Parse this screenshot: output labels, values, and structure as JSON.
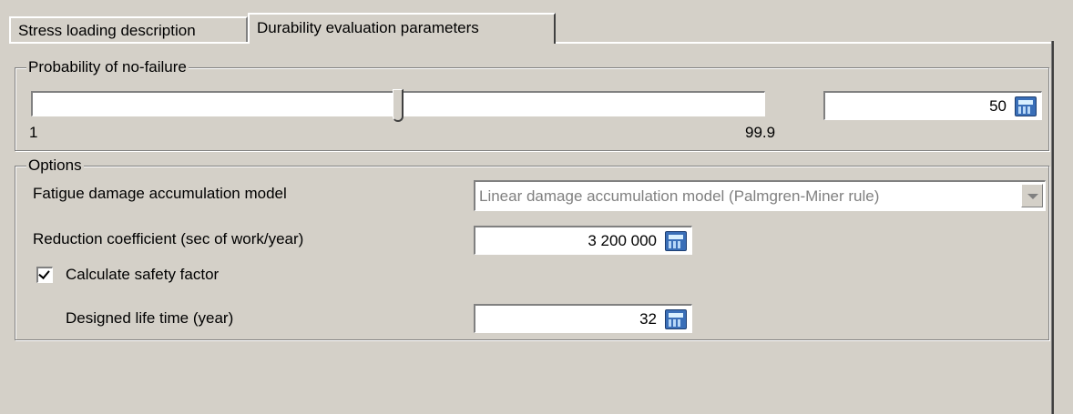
{
  "tabs": [
    {
      "label": "Stress loading description",
      "active": false
    },
    {
      "label": "Durability evaluation parameters",
      "active": true
    }
  ],
  "probability": {
    "group_label": "Probability of no-failure",
    "slider_min_label": "1",
    "slider_max_label": "99.9",
    "slider_level_percent": 50,
    "value": "50"
  },
  "options": {
    "group_label": "Options",
    "fatigue_model_label": "Fatigue damage accumulation model",
    "fatigue_model_value": "Linear damage accumulation model (Palmgren-Miner rule)",
    "reduction_label": "Reduction coefficient (sec of work/year)",
    "reduction_value": "3 200 000",
    "safety_factor_label": "Calculate safety factor",
    "safety_factor_checked": true,
    "life_time_label": "Designed life time (year)",
    "life_time_value": "32"
  },
  "icons": {
    "calculator": "calculator-icon",
    "dropdown": "chevron-down-icon",
    "check": "check-icon"
  },
  "colors": {
    "window_bg": "#d4d0c8",
    "calc_button": "#3a6fb8",
    "disabled_text": "#808080"
  }
}
